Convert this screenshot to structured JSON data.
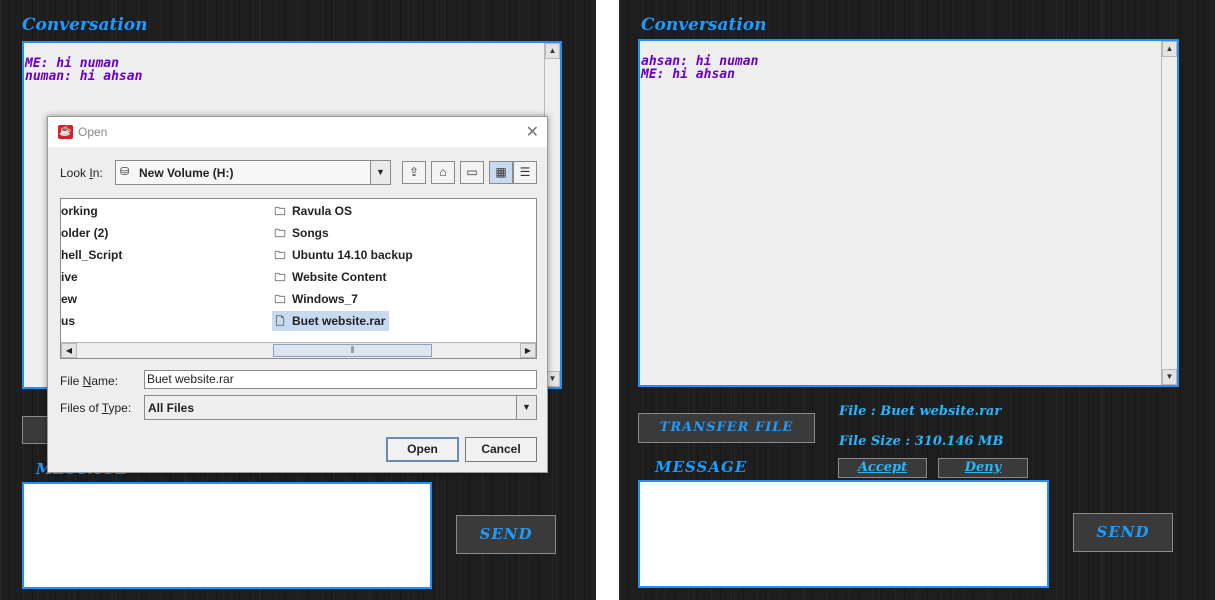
{
  "left": {
    "conversation_title": "Conversation",
    "messages": [
      "ME: hi numan",
      "numan: hi ahsan"
    ],
    "message_label": "MESSAGE",
    "send_label": "SEND"
  },
  "right": {
    "conversation_title": "Conversation",
    "messages": [
      "ahsan: hi numan",
      "ME: hi ahsan"
    ],
    "message_label": "MESSAGE",
    "transfer_label": "TRANSFER FILE",
    "file_line": "File : Buet website.rar",
    "file_size_line": "File Size : 310.146 MB",
    "accept_label": "Accept",
    "deny_label": "Deny",
    "send_label": "SEND"
  },
  "dialog": {
    "title": "Open",
    "close_glyph": "✕",
    "look_in_label": "Look In:",
    "look_in_value": "New Volume (H:)",
    "files_col1": [
      "orking",
      "older (2)",
      "hell_Script",
      "ive",
      "ew",
      "us"
    ],
    "files_col2": [
      "Ravula OS",
      "Songs",
      "Ubuntu 14.10 backup",
      "Website Content",
      "Windows_7",
      "Buet website.rar"
    ],
    "file_name_label": "File Name:",
    "file_name_value": "Buet website.rar",
    "file_type_label": "Files of Type:",
    "file_type_value": "All Files",
    "open_label": "Open",
    "cancel_label": "Cancel"
  },
  "icons": {
    "folder": "folder-icon",
    "file": "file-icon",
    "drive": "drive-icon",
    "up_folder": "up-folder-icon",
    "home": "home-icon",
    "new_folder": "new-folder-icon",
    "list_view": "list-view-icon",
    "details_view": "details-view-icon"
  },
  "colors": {
    "accent_blue": "#1e90ff",
    "chat_text": "#6a00c8",
    "panel_bg": "#1e1e1e"
  }
}
